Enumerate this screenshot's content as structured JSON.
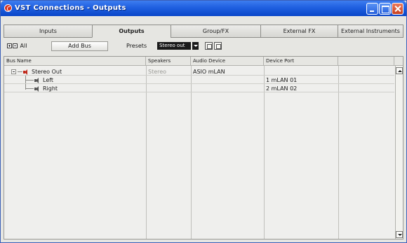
{
  "window": {
    "title": "VST Connections - Outputs"
  },
  "tabs": [
    {
      "label": "Inputs",
      "active": false
    },
    {
      "label": "Outputs",
      "active": true
    },
    {
      "label": "Group/FX",
      "active": false
    },
    {
      "label": "External FX",
      "active": false
    },
    {
      "label": "External Instruments",
      "active": false
    }
  ],
  "toolbar": {
    "all_label": "All",
    "add_bus_label": "Add Bus",
    "presets_label": "Presets",
    "preset_value": "Stereo out"
  },
  "table": {
    "columns": [
      "Bus Name",
      "Speakers",
      "Audio Device",
      "Device Port"
    ],
    "rows": [
      {
        "name": "Stereo Out",
        "speakers": "Stereo",
        "audio_device": "ASIO mLAN",
        "device_port": ""
      },
      {
        "name": "Left",
        "speakers": "",
        "audio_device": "",
        "device_port": "1 mLAN 01"
      },
      {
        "name": "Right",
        "speakers": "",
        "audio_device": "",
        "device_port": "2 mLAN 02"
      }
    ]
  },
  "icons": {
    "app": "app-icon",
    "stereo_bus": "speaker-icon",
    "channel": "speaker-icon"
  },
  "colors": {
    "titlebar": "#1f5fe0",
    "speaker_active": "#c0281a",
    "preset_bg": "#1a1a1a"
  }
}
